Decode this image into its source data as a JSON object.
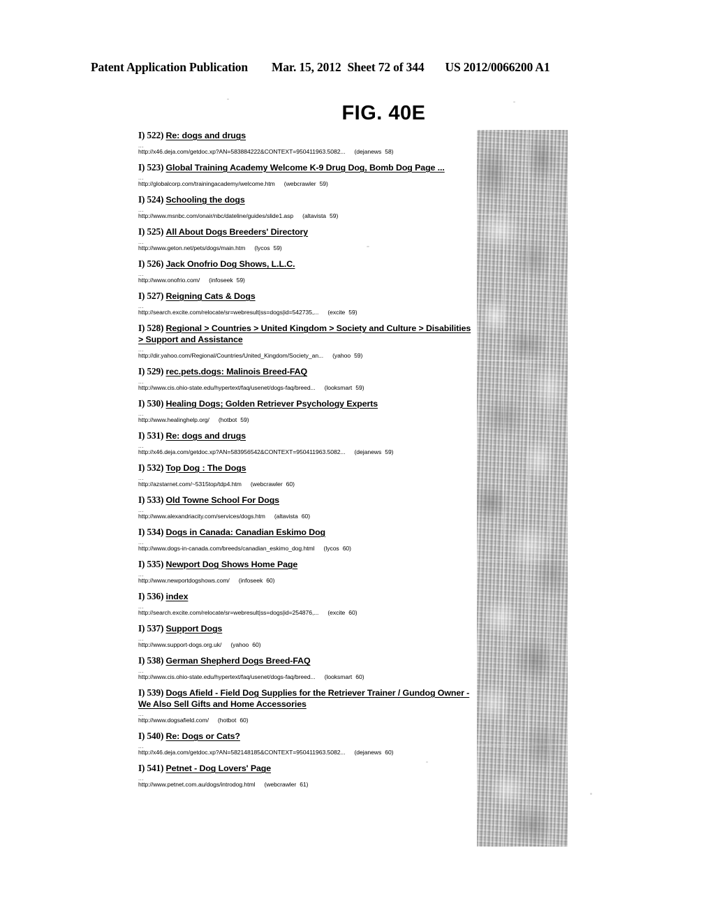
{
  "header": {
    "publication": "Patent Application Publication",
    "date": "Mar. 15, 2012",
    "sheet": "Sheet 72 of 344",
    "patent_number": "US 2012/0066200 A1"
  },
  "figure": {
    "title": "FIG. 40E"
  },
  "list": {
    "prefix": "I)",
    "ellipsis": "...",
    "items": [
      {
        "number": "522)",
        "title": "Re: dogs and drugs",
        "url": "http://x46.deja.com/getdoc.xp?AN=583884222&CONTEXT=950411963.5082...",
        "engine": "(dejanews",
        "rank": "58)"
      },
      {
        "number": "523)",
        "title": "Global Training Academy Welcome K-9 Drug Dog, Bomb Dog Page  ...",
        "url": "http://globalcorp.com/trainingacademy/welcome.htm",
        "engine": "(webcrawler",
        "rank": "59)"
      },
      {
        "number": "524)",
        "title": "Schooling the dogs",
        "url": "http://www.msnbc.com/onair/nbc/dateline/guides/slide1.asp",
        "engine": "(altavista",
        "rank": "59)"
      },
      {
        "number": "525)",
        "title": "All About Dogs Breeders' Directory",
        "url": "http://www.geton.net/pets/dogs/main.htm",
        "engine": "(lycos",
        "rank": "59)"
      },
      {
        "number": "526)",
        "title": "Jack Onofrio Dog Shows, L.L.C.",
        "url": "http://www.onofrio.com/",
        "engine": "(infoseek",
        "rank": "59)"
      },
      {
        "number": "527)",
        "title": "Reigning Cats & Dogs",
        "url": "http://search.excite.com/relocate/sr=webresult|ss=dogs|id=542735,...",
        "engine": "(excite",
        "rank": "59)"
      },
      {
        "number": "528)",
        "title": "Regional > Countries > United Kingdom > Society and Culture > Disabilities > Support and Assistance ",
        "url": "http://dir.yahoo.com/Regional/Countries/United_Kingdom/Society_an...",
        "engine": "(yahoo",
        "rank": "59)"
      },
      {
        "number": "529)",
        "title": "rec.pets.dogs: Malinois Breed-FAQ",
        "url": "http://www.cis.ohio-state.edu/hypertext/faq/usenet/dogs-faq/breed...",
        "engine": "(looksmart",
        "rank": "59)"
      },
      {
        "number": "530)",
        "title": "Healing Dogs; Golden Retriever Psychology Experts",
        "url": "http://www.healinghelp.org/",
        "engine": "(hotbot",
        "rank": "59)"
      },
      {
        "number": "531)",
        "title": "Re: dogs and drugs",
        "url": "http://x46.deja.com/getdoc.xp?AN=583956542&CONTEXT=950411963.5082...",
        "engine": "(dejanews",
        "rank": "59)"
      },
      {
        "number": "532)",
        "title": "Top Dog : The Dogs",
        "url": "http://azstarnet.com/~5315top/tdp4.htm",
        "engine": "(webcrawler",
        "rank": "60)"
      },
      {
        "number": "533)",
        "title": "Old Towne School For Dogs",
        "url": "http://www.alexandriacity.com/services/dogs.htm",
        "engine": "(altavista",
        "rank": "60)"
      },
      {
        "number": "534)",
        "title": "Dogs in Canada: Canadian Eskimo Dog",
        "url": "http://www.dogs-in-canada.com/breeds/canadian_eskimo_dog.html",
        "engine": "(lycos",
        "rank": "60)"
      },
      {
        "number": "535)",
        "title": "Newport Dog Shows Home Page",
        "url": "http://www.newportdogshows.com/",
        "engine": "(infoseek",
        "rank": "60)"
      },
      {
        "number": "536)",
        "title": "index",
        "url": "http://search.excite.com/relocate/sr=webresult|ss=dogs|id=254876,...",
        "engine": "(excite",
        "rank": "60)"
      },
      {
        "number": "537)",
        "title": "Support Dogs",
        "url": "http://www.support-dogs.org.uk/",
        "engine": "(yahoo",
        "rank": "60)"
      },
      {
        "number": "538)",
        "title": "German Shepherd Dogs Breed-FAQ",
        "url": "http://www.cis.ohio-state.edu/hypertext/faq/usenet/dogs-faq/breed...",
        "engine": "(looksmart",
        "rank": "60)"
      },
      {
        "number": "539)",
        "title": "Dogs Afield - Field Dog Supplies for the Retriever Trainer / Gundog Owner - We Also Sell Gifts and Home Accessories",
        "url": "http://www.dogsafield.com/",
        "engine": "(hotbot",
        "rank": "60)"
      },
      {
        "number": "540)",
        "title": "Re: Dogs or Cats?",
        "url": "http://x46.deja.com/getdoc.xp?AN=582148185&CONTEXT=950411963.5082...",
        "engine": "(dejanews",
        "rank": "60)"
      },
      {
        "number": "541)",
        "title": "Petnet - Dog Lovers' Page",
        "url": "http://www.petnet.com.au/dogs/introdog.html",
        "engine": "(webcrawler",
        "rank": "61)"
      }
    ]
  },
  "artifact": {
    "description": "scan-noise-band",
    "color": "#c3c3c3"
  }
}
